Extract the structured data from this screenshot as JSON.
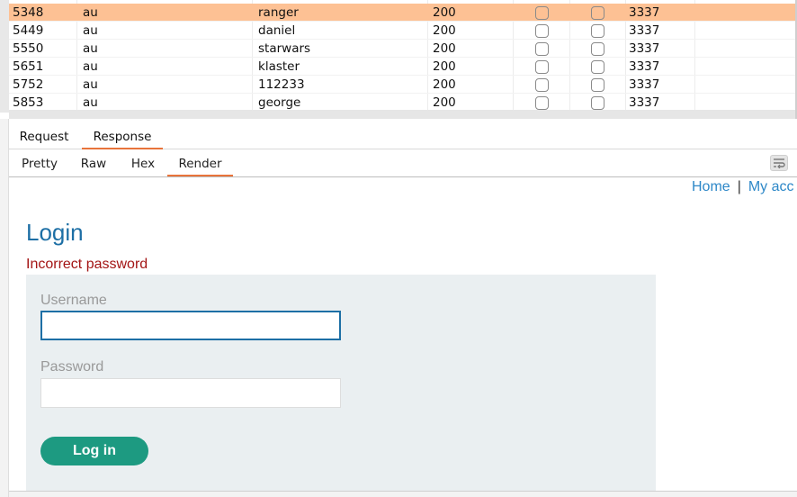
{
  "results": {
    "rows": [
      {
        "id": "5348",
        "payload1": "au",
        "payload2": "ranger",
        "status": "200",
        "length": "3337",
        "selected": true
      },
      {
        "id": "5449",
        "payload1": "au",
        "payload2": "daniel",
        "status": "200",
        "length": "3337",
        "selected": false
      },
      {
        "id": "5550",
        "payload1": "au",
        "payload2": "starwars",
        "status": "200",
        "length": "3337",
        "selected": false
      },
      {
        "id": "5651",
        "payload1": "au",
        "payload2": "klaster",
        "status": "200",
        "length": "3337",
        "selected": false
      },
      {
        "id": "5752",
        "payload1": "au",
        "payload2": "112233",
        "status": "200",
        "length": "3337",
        "selected": false
      },
      {
        "id": "5853",
        "payload1": "au",
        "payload2": "george",
        "status": "200",
        "length": "3337",
        "selected": false
      }
    ]
  },
  "message_tabs": {
    "request": "Request",
    "response": "Response",
    "active": "response"
  },
  "view_tabs": {
    "pretty": "Pretty",
    "raw": "Raw",
    "hex": "Hex",
    "render": "Render",
    "active": "render"
  },
  "rendered_page": {
    "nav": {
      "home": "Home",
      "separator": "|",
      "my_account": "My acc"
    },
    "title": "Login",
    "error": "Incorrect password",
    "username_label": "Username",
    "username_value": "",
    "password_label": "Password",
    "password_value": "",
    "login_button": "Log in"
  },
  "colors": {
    "selected_row": "#fdc194",
    "tab_accent": "#e8743b",
    "link": "#2e88c8",
    "title": "#1d6fa5",
    "error": "#a31515",
    "button": "#1d9a81"
  },
  "icons": {
    "wrap": "word-wrap-icon"
  }
}
